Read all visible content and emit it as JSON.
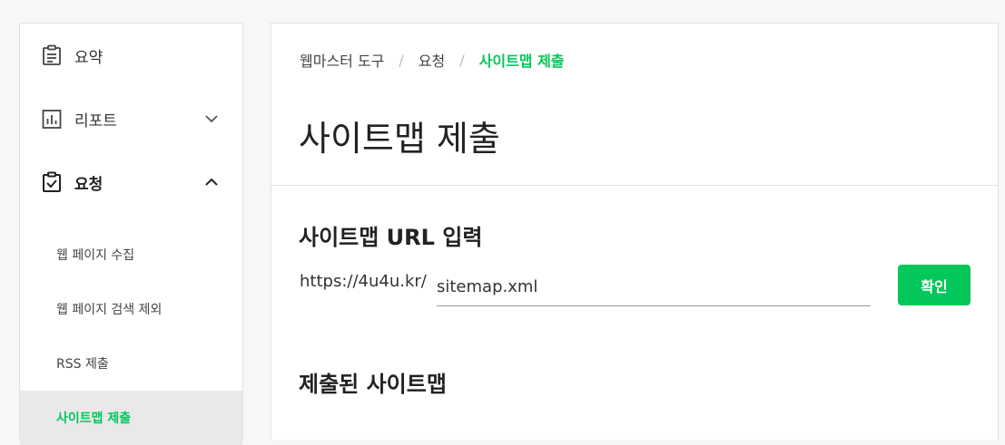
{
  "sidebar": {
    "items": [
      {
        "label": "요약",
        "icon": "clipboard-icon"
      },
      {
        "label": "리포트",
        "icon": "bar-chart-icon",
        "chevron": "chevron-down-icon"
      },
      {
        "label": "요청",
        "icon": "checked-clipboard-icon",
        "chevron": "chevron-up-icon",
        "active": true
      }
    ],
    "sub_items": [
      {
        "label": "웹 페이지 수집"
      },
      {
        "label": "웹 페이지 검색 제외"
      },
      {
        "label": "RSS 제출"
      },
      {
        "label": "사이트맵 제출",
        "current": true
      }
    ]
  },
  "breadcrumb": {
    "items": [
      "웹마스터 도구",
      "요청",
      "사이트맵 제출"
    ],
    "separator": "/"
  },
  "main": {
    "title": "사이트맵 제출",
    "url_section": {
      "title": "사이트맵 URL 입력",
      "prefix": "https://4u4u.kr/",
      "input_value": "sitemap.xml",
      "button_label": "확인"
    },
    "submitted_section": {
      "title": "제출된 사이트맵"
    }
  },
  "colors": {
    "accent": "#03c75a",
    "text": "#333333",
    "border": "#e2e2e2",
    "selected_bg": "#e9e9e9"
  }
}
